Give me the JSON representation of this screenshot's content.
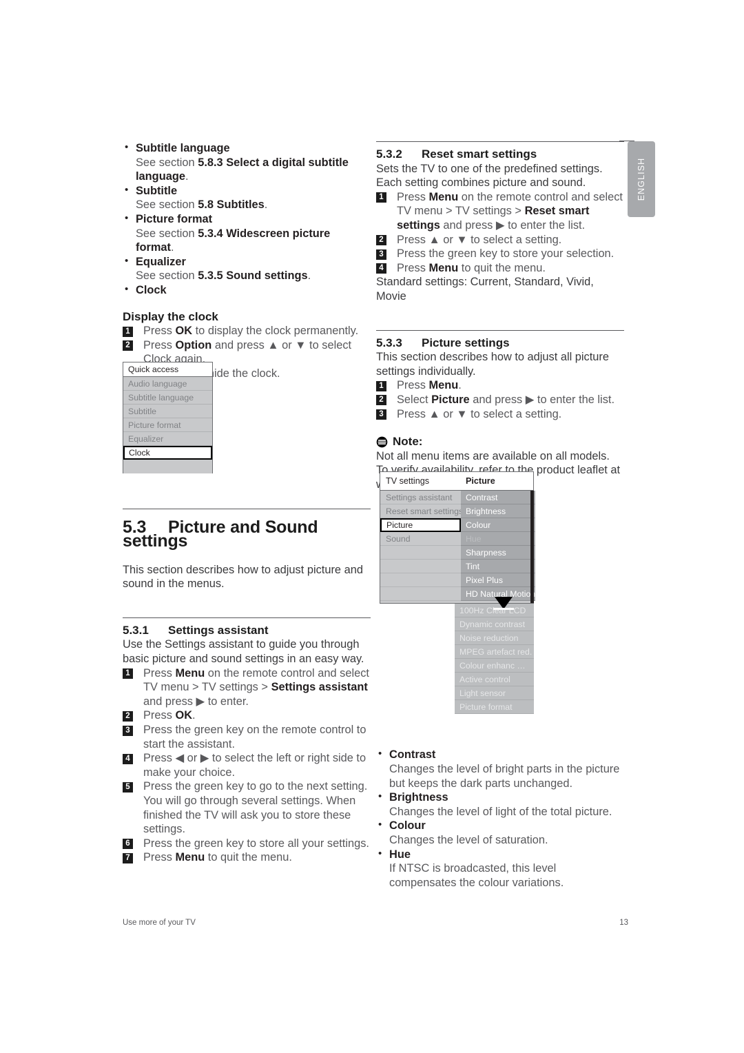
{
  "language_tab": {
    "label": "ENGLISH"
  },
  "left_column": {
    "top_bullets": [
      {
        "term": "Subtitle language",
        "desc_prefix": "See section ",
        "desc_bold": "5.8.3 Select a digital subtitle language",
        "desc_suffix": "."
      },
      {
        "term": "Subtitle",
        "desc_prefix": "See section ",
        "desc_bold": "5.8 Subtitles",
        "desc_suffix": "."
      },
      {
        "term": "Picture format",
        "desc_prefix": "See section ",
        "desc_bold": "5.3.4 Widescreen picture format",
        "desc_suffix": "."
      },
      {
        "term": "Equalizer",
        "desc_prefix": "See section ",
        "desc_bold": "5.3.5 Sound settings",
        "desc_suffix": "."
      },
      {
        "term": "Clock",
        "desc_prefix": "",
        "desc_bold": "",
        "desc_suffix": ""
      }
    ],
    "display_clock": {
      "heading": "Display the clock",
      "steps": [
        {
          "num": "1",
          "parts": [
            {
              "t": "Press ",
              "b": false
            },
            {
              "t": "OK",
              "b": true
            },
            {
              "t": " to display the clock permanently.",
              "b": false
            }
          ]
        },
        {
          "num": "2",
          "parts": [
            {
              "t": "Press ",
              "b": false
            },
            {
              "t": "Option",
              "b": true
            },
            {
              "t": " and press ▲ or ▼ to select Clock again.",
              "b": false
            }
          ]
        },
        {
          "num": "3",
          "parts": [
            {
              "t": "Press ",
              "b": false
            },
            {
              "t": "OK",
              "b": true
            },
            {
              "t": " to hide the clock.",
              "b": false
            }
          ]
        }
      ]
    },
    "quick_access_menu": {
      "title": "Quick access",
      "items": [
        {
          "label": "Audio language",
          "selected": false
        },
        {
          "label": "Subtitle language",
          "selected": false
        },
        {
          "label": "Subtitle",
          "selected": false
        },
        {
          "label": "Picture format",
          "selected": false
        },
        {
          "label": "Equalizer",
          "selected": false
        },
        {
          "label": "Clock",
          "selected": true
        }
      ]
    },
    "section_5_3": {
      "number": "5.3",
      "title": "Picture and Sound settings",
      "intro": "This section describes how to adjust picture and sound in the menus."
    },
    "section_5_3_1": {
      "number": "5.3.1",
      "title": "Settings assistant",
      "intro": "Use the Settings assistant to guide you through basic picture and sound settings in an easy way.",
      "steps": [
        {
          "num": "1",
          "parts": [
            {
              "t": "Press ",
              "b": false
            },
            {
              "t": "Menu",
              "b": true
            },
            {
              "t": " on the remote control and select TV menu > TV settings > ",
              "b": false
            },
            {
              "t": "Settings assistant",
              "b": true
            },
            {
              "t": " and press ▶ to enter.",
              "b": false
            }
          ]
        },
        {
          "num": "2",
          "parts": [
            {
              "t": "Press ",
              "b": false
            },
            {
              "t": "OK",
              "b": true
            },
            {
              "t": ".",
              "b": false
            }
          ]
        },
        {
          "num": "3",
          "parts": [
            {
              "t": "Press the green key on the remote control to start the assistant.",
              "b": false
            }
          ]
        },
        {
          "num": "4",
          "parts": [
            {
              "t": "Press ◀ or ▶ to select the left or right side to make your choice.",
              "b": false
            }
          ]
        },
        {
          "num": "5",
          "parts": [
            {
              "t": "Press the green key to go to the next setting. You will go through several settings. When finished the TV will ask you to store these settings.",
              "b": false
            }
          ]
        },
        {
          "num": "6",
          "parts": [
            {
              "t": "Press the green key to store all your settings.",
              "b": false
            }
          ]
        },
        {
          "num": "7",
          "parts": [
            {
              "t": "Press ",
              "b": false
            },
            {
              "t": "Menu",
              "b": true
            },
            {
              "t": " to quit the menu.",
              "b": false
            }
          ]
        }
      ]
    }
  },
  "right_column": {
    "section_5_3_2": {
      "number": "5.3.2",
      "title": "Reset smart settings",
      "intro": "Sets the TV to one of the predefined settings. Each setting combines picture and sound.",
      "steps": [
        {
          "num": "1",
          "parts": [
            {
              "t": "Press ",
              "b": false
            },
            {
              "t": "Menu",
              "b": true
            },
            {
              "t": " on the remote control and select TV menu > TV settings > ",
              "b": false
            },
            {
              "t": "Reset smart settings",
              "b": true
            },
            {
              "t": " and press ▶ to enter the list.",
              "b": false
            }
          ]
        },
        {
          "num": "2",
          "parts": [
            {
              "t": "Press ▲ or ▼ to select a setting.",
              "b": false
            }
          ]
        },
        {
          "num": "3",
          "parts": [
            {
              "t": "Press the green key to store your selection.",
              "b": false
            }
          ]
        },
        {
          "num": "4",
          "parts": [
            {
              "t": "Press ",
              "b": false
            },
            {
              "t": "Menu",
              "b": true
            },
            {
              "t": " to quit the menu.",
              "b": false
            }
          ]
        }
      ],
      "outro": "Standard settings: Current, Standard, Vivid, Movie"
    },
    "section_5_3_3": {
      "number": "5.3.3",
      "title": "Picture settings",
      "intro": "This section describes how to adjust all picture settings individually.",
      "steps": [
        {
          "num": "1",
          "parts": [
            {
              "t": "Press ",
              "b": false
            },
            {
              "t": "Menu",
              "b": true
            },
            {
              "t": ".",
              "b": false
            }
          ]
        },
        {
          "num": "2",
          "parts": [
            {
              "t": "Select ",
              "b": false
            },
            {
              "t": "Picture",
              "b": true
            },
            {
              "t": " and press ▶ to enter the list.",
              "b": false
            }
          ]
        },
        {
          "num": "3",
          "parts": [
            {
              "t": "Press ▲ or ▼ to select a setting.",
              "b": false
            }
          ]
        }
      ]
    },
    "note": {
      "label": "Note",
      "colon": ":",
      "text": "Not all menu items are available on all models. To verify availability, refer to the product leaflet at www. philips.com/support."
    },
    "tv_settings_menu": {
      "header_left": "TV settings",
      "header_right": "Picture",
      "left_items": [
        {
          "label": "Settings assistant",
          "selected": false
        },
        {
          "label": "Reset smart settings",
          "selected": false
        },
        {
          "label": "Picture",
          "selected": true
        },
        {
          "label": "Sound",
          "selected": false
        },
        {
          "label": "",
          "selected": false
        },
        {
          "label": "",
          "selected": false
        },
        {
          "label": "",
          "selected": false
        },
        {
          "label": "",
          "selected": false
        }
      ],
      "right_items": [
        {
          "label": "Contrast",
          "dim": false
        },
        {
          "label": "Brightness",
          "dim": false
        },
        {
          "label": "Colour",
          "dim": false
        },
        {
          "label": "Hue",
          "dim": true
        },
        {
          "label": "Sharpness",
          "dim": false
        },
        {
          "label": "Tint",
          "dim": false
        },
        {
          "label": "Pixel Plus",
          "dim": false
        },
        {
          "label": "HD Natural Motion",
          "dim": false
        }
      ],
      "overflow_items": [
        {
          "label": "100Hz Clear LCD"
        },
        {
          "label": "Dynamic contrast"
        },
        {
          "label": "Noise reduction"
        },
        {
          "label": "MPEG artefact red."
        },
        {
          "label": "Colour enhanc …"
        },
        {
          "label": "Active control"
        },
        {
          "label": "Light sensor"
        },
        {
          "label": "Picture format"
        }
      ]
    },
    "picture_bullets": [
      {
        "term": "Contrast",
        "desc": "Changes the level of bright parts in the picture but keeps the dark parts unchanged."
      },
      {
        "term": "Brightness",
        "desc": "Changes the level of light of the total picture."
      },
      {
        "term": "Colour",
        "desc": "Changes the level of saturation."
      },
      {
        "term": "Hue",
        "desc": "If NTSC is broadcasted, this level compensates the colour variations."
      }
    ]
  },
  "footer": {
    "left": "Use more of your TV",
    "page_number": "13"
  }
}
